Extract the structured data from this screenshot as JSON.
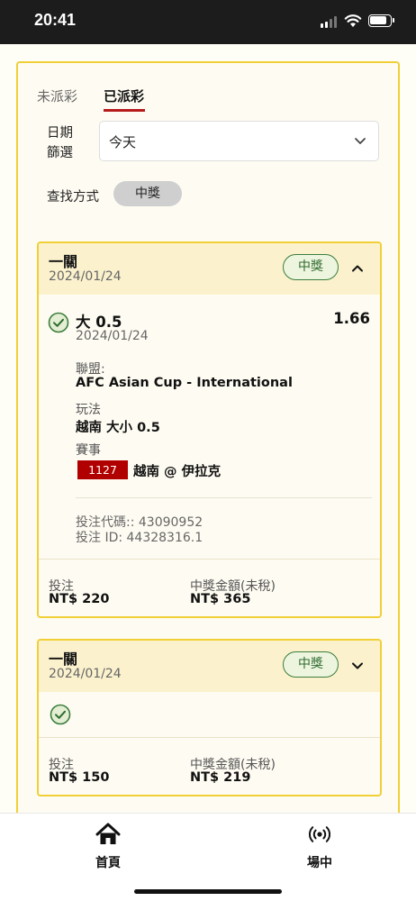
{
  "status_bar": {
    "time": "20:41"
  },
  "tabs": {
    "unsettled": "未派彩",
    "settled": "已派彩"
  },
  "filter": {
    "date_label": "日期篩選",
    "date_value": "今天",
    "search_label": "查找方式",
    "search_value": "中獎"
  },
  "bets": [
    {
      "type": "一關",
      "date": "2024/01/24",
      "status": "中獎",
      "selection": "大 0.5",
      "selection_date": "2024/01/24",
      "odds": "1.66",
      "league_label": "聯盟:",
      "league": "AFC Asian Cup - International",
      "market_label": "玩法",
      "market": "越南 大小 0.5",
      "event_label": "賽事",
      "match_id": "1127",
      "teams": "越南 @ 伊拉克",
      "bet_code": "投注代碼:: 43090952",
      "bet_id": "投注 ID: 44328316.1",
      "stake_label": "投注",
      "stake": "NT$ 220",
      "payout_label": "中獎金額(未稅)",
      "payout": "NT$ 365"
    },
    {
      "type": "一關",
      "date": "2024/01/24",
      "status": "中獎",
      "stake_label": "投注",
      "stake": "NT$ 150",
      "payout_label": "中獎金額(未稅)",
      "payout": "NT$ 219"
    }
  ],
  "nav": {
    "home": "首頁",
    "live": "場中"
  },
  "icons": [
    "signal-icon",
    "wifi-icon",
    "battery-icon",
    "chevron-down-icon",
    "chevron-up-icon",
    "check-circle-icon",
    "home-icon",
    "live-broadcast-icon"
  ],
  "colors": {
    "accent_border": "#f0cf37",
    "win_green": "#3c7d3c",
    "active_tab": "#b71c1c",
    "match_badge": "#b00000"
  }
}
